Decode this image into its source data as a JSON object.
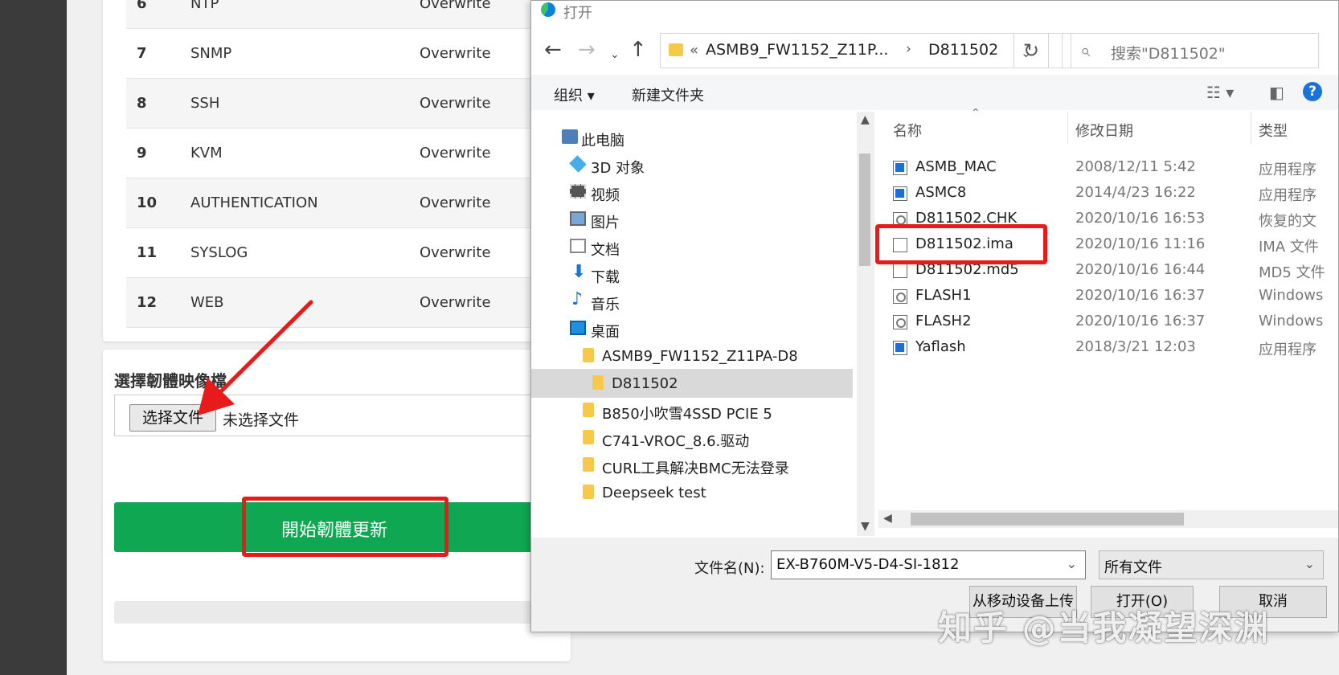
{
  "background": {
    "config_rows": [
      {
        "no": "6",
        "name": "NTP",
        "mode": "Overwrite"
      },
      {
        "no": "7",
        "name": "SNMP",
        "mode": "Overwrite"
      },
      {
        "no": "8",
        "name": "SSH",
        "mode": "Overwrite"
      },
      {
        "no": "9",
        "name": "KVM",
        "mode": "Overwrite"
      },
      {
        "no": "10",
        "name": "AUTHENTICATION",
        "mode": "Overwrite"
      },
      {
        "no": "11",
        "name": "SYSLOG",
        "mode": "Overwrite"
      },
      {
        "no": "12",
        "name": "WEB",
        "mode": "Overwrite"
      }
    ],
    "select_label": "選擇韌體映像檔",
    "choose_file_button": "选择文件",
    "file_status": "未选择文件",
    "start_button": "開始韌體更新",
    "accent_green": "#0fa751",
    "highlight_red": "#e81a1a"
  },
  "dialog": {
    "title": "打开",
    "address": {
      "part1": "ASMB9_FW1152_Z11P...",
      "separator": "›",
      "part2": "D811502",
      "prefix": "«"
    },
    "search_placeholder": "搜索\"D811502\"",
    "commands": {
      "organize": "组织 ▾",
      "new_folder": "新建文件夹"
    },
    "tree": [
      {
        "label": "此电脑",
        "icon": "computer-icon"
      },
      {
        "label": "3D 对象",
        "icon": "3d-objects-icon"
      },
      {
        "label": "视频",
        "icon": "video-icon"
      },
      {
        "label": "图片",
        "icon": "pictures-icon"
      },
      {
        "label": "文档",
        "icon": "documents-icon"
      },
      {
        "label": "下载",
        "icon": "download-icon"
      },
      {
        "label": "音乐",
        "icon": "music-icon"
      },
      {
        "label": "桌面",
        "icon": "desktop-icon"
      },
      {
        "label": "ASMB9_FW1152_Z11PA-D8",
        "icon": "folder-icon"
      },
      {
        "label": "D811502",
        "icon": "folder-icon",
        "selected": true
      },
      {
        "label": "B850小吹雪4SSD PCIE 5",
        "icon": "folder-icon"
      },
      {
        "label": "C741-VROC_8.6.驱动",
        "icon": "folder-icon"
      },
      {
        "label": "CURL工具解决BMC无法登录",
        "icon": "folder-icon"
      },
      {
        "label": "Deepseek test",
        "icon": "folder-icon"
      }
    ],
    "columns": {
      "name": "名称",
      "date": "修改日期",
      "type": "类型"
    },
    "files": [
      {
        "name": "ASMB_MAC",
        "date": "2008/12/11 5:42",
        "type": "应用程序",
        "icon": "application-icon"
      },
      {
        "name": "ASMC8",
        "date": "2014/4/23 16:22",
        "type": "应用程序",
        "icon": "application-icon"
      },
      {
        "name": "D811502.CHK",
        "date": "2020/10/16 16:53",
        "type": "恢复的文",
        "icon": "system-file-icon"
      },
      {
        "name": "D811502.ima",
        "date": "2020/10/16 11:16",
        "type": "IMA 文件",
        "icon": "file-icon"
      },
      {
        "name": "D811502.md5",
        "date": "2020/10/16 16:44",
        "type": "MD5 文件",
        "icon": "file-icon"
      },
      {
        "name": "FLASH1",
        "date": "2020/10/16 16:37",
        "type": "Windows",
        "icon": "system-file-icon"
      },
      {
        "name": "FLASH2",
        "date": "2020/10/16 16:37",
        "type": "Windows",
        "icon": "system-file-icon"
      },
      {
        "name": "Yaflash",
        "date": "2018/3/21 12:03",
        "type": "应用程序",
        "icon": "application-icon"
      }
    ],
    "filename_label": "文件名(N):",
    "filename_value": "EX-B760M-V5-D4-SI-1812",
    "filetype_value": "所有文件",
    "buttons": {
      "upload": "从移动设备上传",
      "open": "打开(O)",
      "cancel": "取消"
    }
  },
  "watermark": "知乎 @当我凝望深渊"
}
